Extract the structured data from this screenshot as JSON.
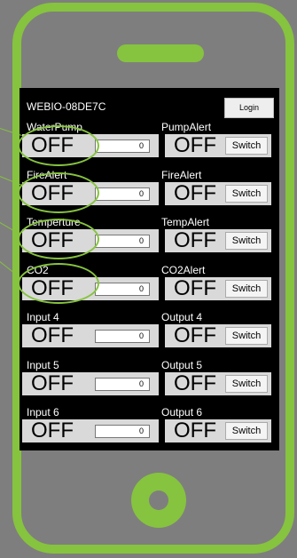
{
  "device": {
    "title": "WEBIO-08DE7C",
    "login_label": "Login"
  },
  "rows": [
    {
      "input_label": "WaterPump",
      "input_state": "OFF",
      "input_value": "0",
      "output_label": "PumpAlert",
      "output_state": "OFF",
      "switch_label": "Switch"
    },
    {
      "input_label": "FireAlert",
      "input_state": "OFF",
      "input_value": "0",
      "output_label": "FireAlert",
      "output_state": "OFF",
      "switch_label": "Switch"
    },
    {
      "input_label": "Temperture",
      "input_state": "OFF",
      "input_value": "0",
      "output_label": "TempAlert",
      "output_state": "OFF",
      "switch_label": "Switch"
    },
    {
      "input_label": "CO2",
      "input_state": "OFF",
      "input_value": "0",
      "output_label": "CO2Alert",
      "output_state": "OFF",
      "switch_label": "Switch"
    },
    {
      "input_label": "Input 4",
      "input_state": "OFF",
      "input_value": "0",
      "output_label": "Output 4",
      "output_state": "OFF",
      "switch_label": "Switch"
    },
    {
      "input_label": "Input 5",
      "input_state": "OFF",
      "input_value": "0",
      "output_label": "Output 5",
      "output_state": "OFF",
      "switch_label": "Switch"
    },
    {
      "input_label": "Input 6",
      "input_state": "OFF",
      "input_value": "0",
      "output_label": "Output 6",
      "output_state": "OFF",
      "switch_label": "Switch"
    }
  ],
  "colors": {
    "accent": "#86c33f",
    "background": "#7e7e7e",
    "screen": "#000000",
    "panel": "#d9d9d9"
  }
}
